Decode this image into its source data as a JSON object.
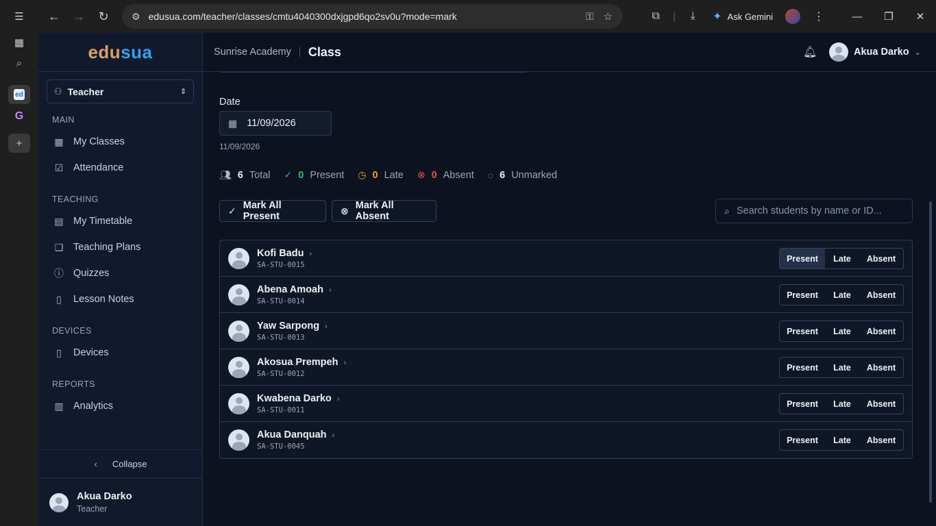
{
  "browser": {
    "url": "edusua.com/teacher/classes/cmtu4040300dxjgpd6qo2sv0u?mode=mark",
    "gemini_label": "Ask Gemini"
  },
  "vtabs": {
    "favicon_edusua": "ed",
    "favicon_g": "G"
  },
  "app": {
    "logo_part1": "edu",
    "logo_part2": "sua"
  },
  "sidebar": {
    "role": "Teacher",
    "sections": {
      "main": "MAIN",
      "teaching": "TEACHING",
      "devices": "DEVICES",
      "reports": "REPORTS"
    },
    "items": {
      "my_classes": "My Classes",
      "attendance": "Attendance",
      "my_timetable": "My Timetable",
      "teaching_plans": "Teaching Plans",
      "quizzes": "Quizzes",
      "lesson_notes": "Lesson Notes",
      "devices": "Devices",
      "analytics": "Analytics"
    },
    "collapse": "Collapse",
    "user": {
      "name": "Akua Darko",
      "role": "Teacher"
    }
  },
  "header": {
    "school": "Sunrise Academy",
    "page": "Class",
    "user": "Akua Darko"
  },
  "attendance": {
    "date_label": "Date",
    "date_value": "11/09/2026",
    "date_sub": "11/09/2026",
    "stats": {
      "total": {
        "count": "6",
        "label": "Total"
      },
      "present": {
        "count": "0",
        "label": "Present"
      },
      "late": {
        "count": "0",
        "label": "Late"
      },
      "absent": {
        "count": "0",
        "label": "Absent"
      },
      "unmarked": {
        "count": "6",
        "label": "Unmarked"
      }
    },
    "mark_all_present": "Mark All Present",
    "mark_all_absent": "Mark All Absent",
    "search_placeholder": "Search students by name or ID...",
    "options": {
      "present": "Present",
      "late": "Late",
      "absent": "Absent"
    },
    "students": [
      {
        "name": "Kofi Badu",
        "id": "SA-STU-0015"
      },
      {
        "name": "Abena Amoah",
        "id": "SA-STU-0014"
      },
      {
        "name": "Yaw Sarpong",
        "id": "SA-STU-0013"
      },
      {
        "name": "Akosua Prempeh",
        "id": "SA-STU-0012"
      },
      {
        "name": "Kwabena Darko",
        "id": "SA-STU-0011"
      },
      {
        "name": "Akua Danquah",
        "id": "SA-STU-0045"
      }
    ]
  },
  "colors": {
    "present": "#2fbf62",
    "late": "#f0a020",
    "absent": "#ef4b4b",
    "logo_edu": "#d9a066",
    "logo_sua": "#3aa0f0"
  }
}
